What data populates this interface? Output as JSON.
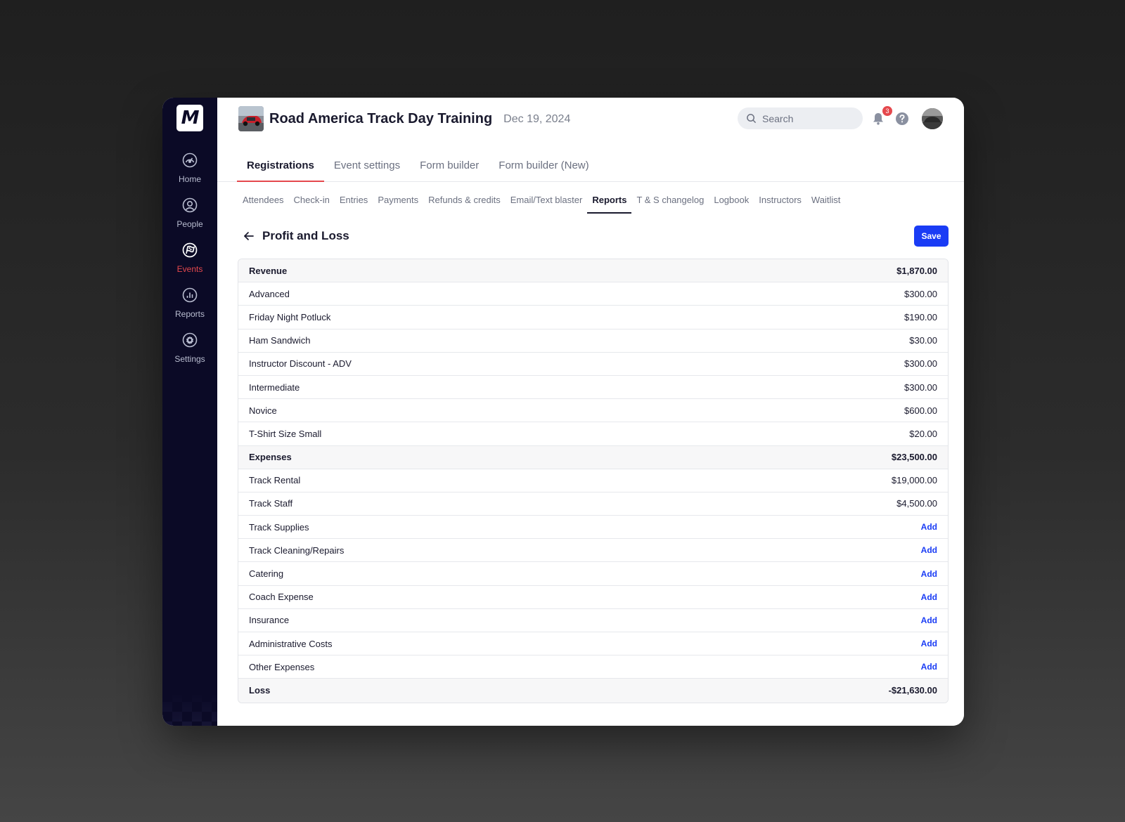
{
  "sidebar": {
    "items": [
      {
        "label": "Home",
        "icon": "gauge-icon"
      },
      {
        "label": "People",
        "icon": "person-icon"
      },
      {
        "label": "Events",
        "icon": "race-flag-icon",
        "active": true
      },
      {
        "label": "Reports",
        "icon": "bar-chart-icon"
      },
      {
        "label": "Settings",
        "icon": "gear-icon"
      }
    ]
  },
  "header": {
    "title": "Road America Track Day Training",
    "date": "Dec 19, 2024",
    "search_placeholder": "Search",
    "notification_count": "3"
  },
  "tabs": [
    {
      "label": "Registrations",
      "active": true
    },
    {
      "label": "Event settings"
    },
    {
      "label": "Form builder"
    },
    {
      "label": "Form builder (New)"
    }
  ],
  "subtabs": [
    {
      "label": "Attendees"
    },
    {
      "label": "Check-in"
    },
    {
      "label": "Entries"
    },
    {
      "label": "Payments"
    },
    {
      "label": "Refunds & credits"
    },
    {
      "label": "Email/Text blaster"
    },
    {
      "label": "Reports",
      "active": true
    },
    {
      "label": "T & S changelog"
    },
    {
      "label": "Logbook"
    },
    {
      "label": "Instructors"
    },
    {
      "label": "Waitlist"
    }
  ],
  "page": {
    "title": "Profit and Loss",
    "save_label": "Save"
  },
  "pl": {
    "add_label": "Add",
    "revenue": {
      "label": "Revenue",
      "total": "$1,870.00",
      "items": [
        {
          "label": "Advanced",
          "value": "$300.00"
        },
        {
          "label": "Friday Night Potluck",
          "value": "$190.00"
        },
        {
          "label": "Ham Sandwich",
          "value": "$30.00"
        },
        {
          "label": "Instructor Discount - ADV",
          "value": "$300.00"
        },
        {
          "label": "Intermediate",
          "value": "$300.00"
        },
        {
          "label": "Novice",
          "value": "$600.00"
        },
        {
          "label": "T-Shirt Size Small",
          "value": "$20.00"
        }
      ]
    },
    "expenses": {
      "label": "Expenses",
      "total": "$23,500.00",
      "items": [
        {
          "label": "Track Rental",
          "value": "$19,000.00"
        },
        {
          "label": "Track Staff",
          "value": "$4,500.00"
        },
        {
          "label": "Track Supplies",
          "value": null
        },
        {
          "label": "Track Cleaning/Repairs",
          "value": null
        },
        {
          "label": "Catering",
          "value": null
        },
        {
          "label": "Coach Expense",
          "value": null
        },
        {
          "label": "Insurance",
          "value": null
        },
        {
          "label": "Administrative Costs",
          "value": null
        },
        {
          "label": "Other Expenses",
          "value": null
        }
      ]
    },
    "result": {
      "label": "Loss",
      "value": "-$21,630.00"
    }
  },
  "colors": {
    "sidebar_bg": "#0b0a26",
    "accent_red": "#e5484d",
    "primary_blue": "#1a3cf5"
  }
}
